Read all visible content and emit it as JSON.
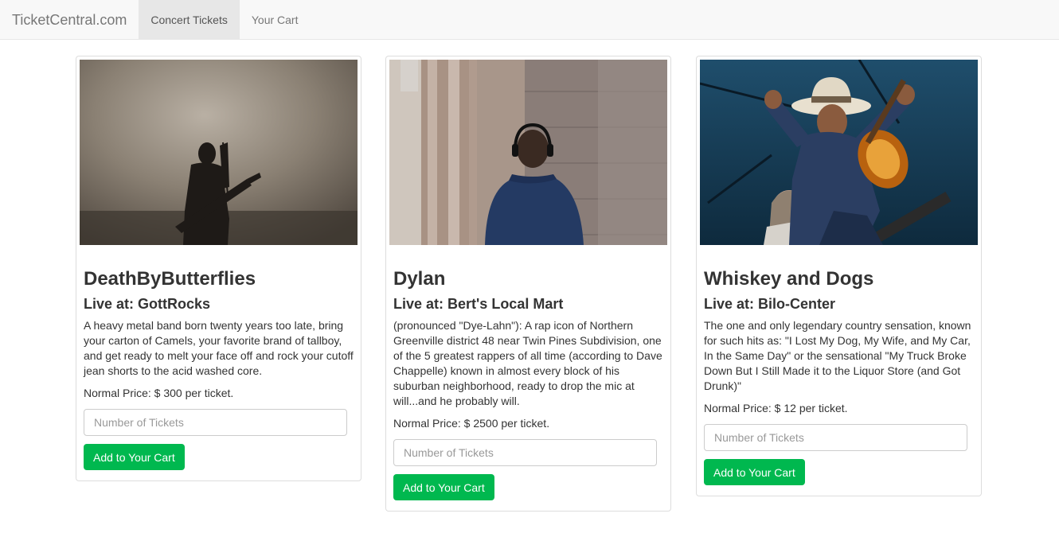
{
  "navbar": {
    "brand": "TicketCentral.com",
    "links": [
      {
        "label": "Concert Tickets",
        "active": true
      },
      {
        "label": "Your Cart",
        "active": false
      }
    ]
  },
  "concerts": [
    {
      "name": "DeathByButterflies",
      "venue": "Live at: GottRocks",
      "description": "A heavy metal band born twenty years too late, bring your carton of Camels, your favorite brand of tallboy, and get ready to melt your face off and rock your cutoff jean shorts to the acid washed core.",
      "price": "Normal Price: $ 300 per ticket.",
      "input_placeholder": "Number of Tickets",
      "button_label": "Add to Your Cart"
    },
    {
      "name": "Dylan",
      "venue": "Live at: Bert's Local Mart",
      "description": "(pronounced \"Dye-Lahn\"): A rap icon of Northern Greenville district 48 near Twin Pines Subdivision, one of the 5 greatest rappers of all time (according to Dave Chappelle) known in almost every block of his suburban neighborhood, ready to drop the mic at will...and he probably will.",
      "price": "Normal Price: $ 2500 per ticket.",
      "input_placeholder": "Number of Tickets",
      "button_label": "Add to Your Cart"
    },
    {
      "name": "Whiskey and Dogs",
      "venue": "Live at: Bilo-Center",
      "description": "The one and only legendary country sensation, known for such hits as: \"I Lost My Dog, My Wife, and My Car, In the Same Day\" or the sensational \"My Truck Broke Down But I Still Made it to the Liquor Store (and Got Drunk)\"",
      "price": "Normal Price: $ 12 per ticket.",
      "input_placeholder": "Number of Tickets",
      "button_label": "Add to Your Cart"
    }
  ],
  "colors": {
    "navbar_bg": "#f8f8f8",
    "active_tab_bg": "#e7e7e7",
    "button_green": "#00b84f",
    "text": "#333333"
  }
}
